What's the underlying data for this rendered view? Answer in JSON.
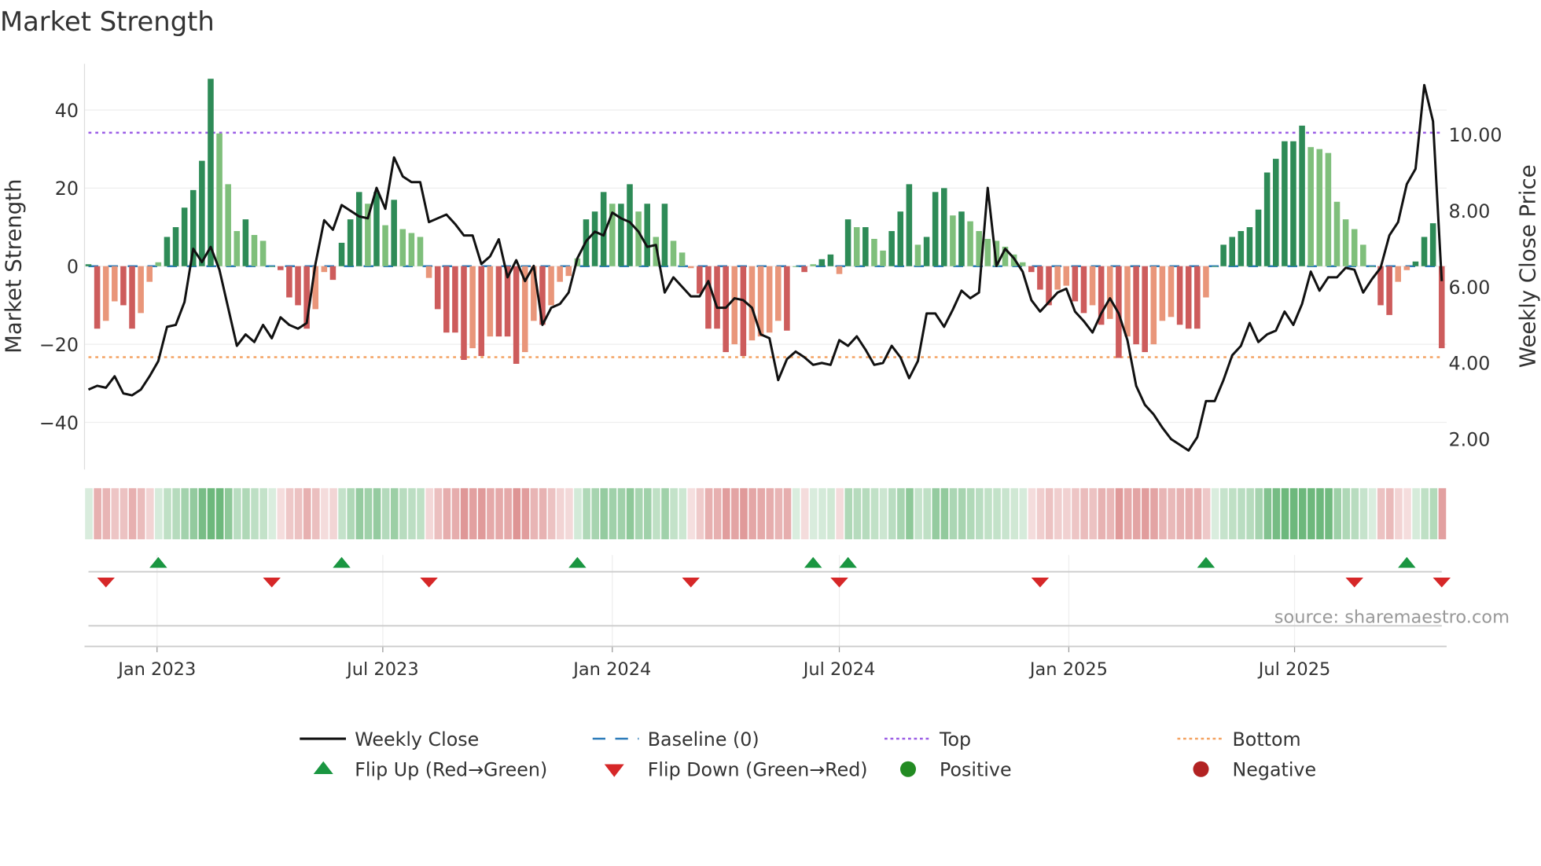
{
  "chart_data": {
    "type": "bar+line",
    "title": "Market Strength",
    "ylabel": "Market Strength",
    "y2label": "Weekly Close Price",
    "ylim": [
      -52,
      52
    ],
    "y2lim": [
      1.15,
      12.5
    ],
    "yticks": [
      40,
      20,
      0,
      -20,
      -40
    ],
    "ytick_labels": [
      "40",
      "20",
      "0",
      "−20",
      "−40"
    ],
    "y2ticks": [
      10,
      8,
      6,
      4,
      2
    ],
    "y2tick_labels": [
      "10.00",
      "8.00",
      "6.00",
      "4.00",
      "2.00"
    ],
    "start_date": "2022-11-07",
    "end_date": "2025-10-27",
    "xticks": [
      "2023-01-01",
      "2023-07-01",
      "2024-01-01",
      "2024-07-01",
      "2025-01-01",
      "2025-07-01"
    ],
    "xtick_labels": [
      "Jan 2023",
      "Jul 2023",
      "Jan 2024",
      "Jul 2024",
      "Jan 2025",
      "Jul 2025"
    ],
    "top_level": 34.2,
    "bottom_level": -23.3,
    "grid": true,
    "strength": [
      0.5,
      -16,
      -14,
      -9,
      -10,
      -16,
      -12,
      -4,
      1,
      7.5,
      10,
      15,
      19.5,
      27,
      48,
      34,
      21,
      9,
      12,
      8,
      6.5,
      0,
      -1,
      -8,
      -10,
      -16,
      -11,
      -1.5,
      -3.5,
      6,
      12,
      19,
      16,
      19,
      10.5,
      17,
      9.5,
      8.5,
      7.5,
      -3,
      -11,
      -17,
      -17,
      -24,
      -21,
      -23,
      -18,
      -18,
      -18,
      -25,
      -22,
      -14,
      -15,
      -10,
      -4,
      -2.5,
      2,
      12,
      14,
      19,
      16,
      16,
      21,
      14,
      16,
      7.5,
      16,
      6.5,
      3.5,
      -0.5,
      -7,
      -16,
      -16,
      -22,
      -20,
      -23,
      -19,
      -18,
      -17,
      -14,
      -16.5,
      0,
      -1.5,
      0.5,
      1.8,
      3,
      -2,
      12,
      10,
      10,
      7,
      4,
      9,
      14,
      21,
      5.5,
      7.5,
      19,
      20,
      13,
      14,
      11.5,
      9,
      7,
      6.5,
      5,
      3,
      1,
      -1.5,
      -6,
      -10,
      -6,
      -5,
      -9,
      -12,
      -10,
      -15,
      -13.5,
      -23.5,
      -18,
      -20,
      -22,
      -20,
      -14,
      -13,
      -15,
      -16,
      -16,
      -8,
      0,
      5.5,
      7.5,
      9,
      10,
      14.5,
      24,
      27.5,
      32,
      32,
      36,
      30.5,
      30,
      29,
      16.5,
      12,
      9.5,
      5.5,
      0,
      -10,
      -12.5,
      -4,
      -1,
      1.2,
      7.5,
      11,
      -21
    ],
    "weekly_close": [
      3.3,
      3.4,
      3.35,
      3.65,
      3.2,
      3.15,
      3.3,
      3.65,
      4.05,
      4.95,
      5.0,
      5.6,
      7.0,
      6.65,
      7.05,
      6.45,
      5.45,
      4.45,
      4.75,
      4.55,
      5.0,
      4.65,
      5.2,
      5.0,
      4.9,
      5.05,
      6.6,
      7.75,
      7.5,
      8.15,
      8.0,
      7.85,
      7.8,
      8.6,
      8.05,
      9.4,
      8.9,
      8.75,
      8.75,
      7.7,
      7.8,
      7.9,
      7.65,
      7.35,
      7.35,
      6.6,
      6.8,
      7.25,
      6.25,
      6.7,
      6.15,
      6.55,
      5.0,
      5.45,
      5.55,
      5.85,
      6.75,
      7.2,
      7.45,
      7.35,
      7.95,
      7.8,
      7.7,
      7.45,
      7.05,
      7.1,
      5.85,
      6.25,
      6.0,
      5.75,
      5.75,
      6.15,
      5.45,
      5.45,
      5.7,
      5.65,
      5.45,
      4.75,
      4.65,
      3.55,
      4.1,
      4.3,
      4.15,
      3.95,
      4.0,
      3.95,
      4.6,
      4.45,
      4.7,
      4.35,
      3.95,
      4.0,
      4.45,
      4.15,
      3.6,
      4.05,
      5.3,
      5.3,
      4.95,
      5.4,
      5.9,
      5.7,
      5.85,
      8.6,
      6.55,
      7.0,
      6.75,
      6.4,
      5.65,
      5.35,
      5.6,
      5.85,
      5.95,
      5.35,
      5.1,
      4.8,
      5.3,
      5.7,
      5.3,
      4.6,
      3.4,
      2.9,
      2.65,
      2.3,
      2.0,
      1.85,
      1.7,
      2.05,
      3.0,
      3.0,
      3.55,
      4.2,
      4.45,
      5.05,
      4.55,
      4.75,
      4.85,
      5.35,
      5.0,
      5.55,
      6.4,
      5.9,
      6.25,
      6.25,
      6.5,
      6.45,
      5.85,
      6.2,
      6.5,
      7.35,
      7.7,
      8.7,
      9.1,
      11.3,
      10.35,
      6.15
    ],
    "flip_up_dates": [
      "2023-01-02",
      "2023-05-29",
      "2023-12-04",
      "2024-06-10",
      "2024-07-08",
      "2025-04-21",
      "2025-09-29"
    ],
    "flip_down_dates": [
      "2022-11-21",
      "2023-04-03",
      "2023-08-07",
      "2024-03-04",
      "2024-07-01",
      "2024-12-09",
      "2025-08-18",
      "2025-10-27"
    ],
    "legend": [
      {
        "label": "Weekly Close",
        "kind": "line",
        "color": "#111111"
      },
      {
        "label": "Baseline (0)",
        "kind": "dash",
        "color": "#2b7bb9"
      },
      {
        "label": "Top",
        "kind": "dot",
        "color": "#9b5de5"
      },
      {
        "label": "Bottom",
        "kind": "dot",
        "color": "#f4a261"
      },
      {
        "label": "Flip Up (Red→Green)",
        "kind": "tri-up",
        "color": "#1a9641"
      },
      {
        "label": "Flip Down (Green→Red)",
        "kind": "tri-down",
        "color": "#d62728"
      },
      {
        "label": "Positive",
        "kind": "circle",
        "color": "#228b22"
      },
      {
        "label": "Negative",
        "kind": "circle",
        "color": "#b22222"
      }
    ],
    "legend_position": "bottom",
    "source": "source: sharemaestro.com"
  },
  "colors": {
    "pos_strong": "#2e8b57",
    "pos_weak": "#7fbf7b",
    "neg_strong": "#cd5c5c",
    "neg_weak": "#e9967a"
  }
}
